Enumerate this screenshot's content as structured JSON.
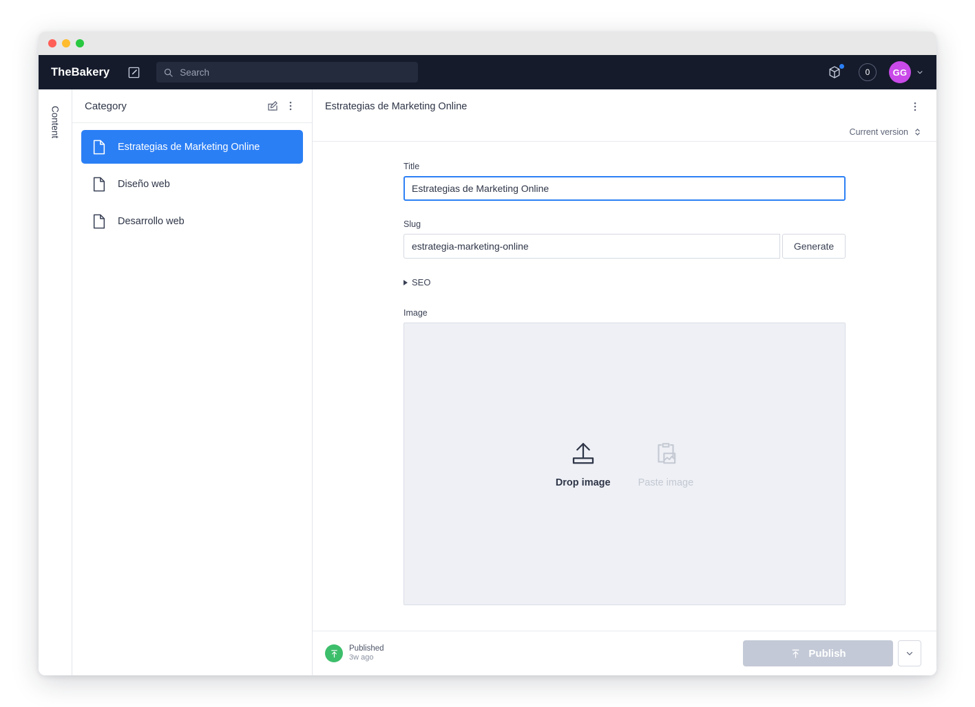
{
  "window": {
    "traffic_lights": [
      "close",
      "minimize",
      "zoom"
    ]
  },
  "appbar": {
    "brand": "TheBakery",
    "compose_icon": "edit-square-icon",
    "search": {
      "icon": "search-icon",
      "placeholder": "Search",
      "value": ""
    },
    "package_icon": "package-icon",
    "notification_count": "0",
    "avatar_initials": "GG",
    "avatar_caret_icon": "chevron-down-icon",
    "avatar_color": "#c94ae8",
    "background": "#151b2b"
  },
  "rail": {
    "label": "Content"
  },
  "sidebar": {
    "title": "Category",
    "edit_icon": "edit-square-icon",
    "more_icon": "more-vertical-icon",
    "items": [
      {
        "label": "Estrategias de Marketing Online",
        "icon": "document-icon",
        "selected": true
      },
      {
        "label": "Diseño web",
        "icon": "document-icon",
        "selected": false
      },
      {
        "label": "Desarrollo web",
        "icon": "document-icon",
        "selected": false
      }
    ],
    "selected_color": "#2b7ff5"
  },
  "main": {
    "title": "Estrategias de Marketing Online",
    "more_icon": "more-vertical-icon",
    "version_label": "Current version",
    "version_icon": "chevron-up-down-icon",
    "form": {
      "title_label": "Title",
      "title_value": "Estrategias de Marketing Online",
      "slug_label": "Slug",
      "slug_value": "estrategia-marketing-online",
      "generate_label": "Generate",
      "seo_label": "SEO",
      "seo_expanded": false,
      "image_label": "Image",
      "drop_label": "Drop image",
      "drop_icon": "upload-icon",
      "paste_label": "Paste image",
      "paste_icon": "clipboard-image-icon",
      "paste_disabled": true
    }
  },
  "footer": {
    "status_icon": "publish-arrow-icon",
    "status_color": "#3dbe6b",
    "status_title": "Published",
    "status_time": "3w ago",
    "publish_label": "Publish",
    "publish_icon": "publish-arrow-icon",
    "publish_caret_icon": "chevron-down-icon",
    "publish_disabled": true
  }
}
